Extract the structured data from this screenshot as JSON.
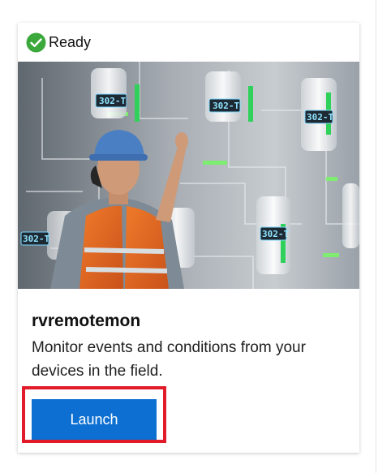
{
  "card": {
    "status": {
      "label": "Ready",
      "icon": "check-circle-icon",
      "color": "#3aa83a"
    },
    "image": {
      "subject": "worker in hard hat and safety vest with industrial tank panels",
      "panel_labels": [
        "302-T",
        "302-T",
        "302-T",
        "302-T",
        "302-T"
      ]
    },
    "title": "rvremotemon",
    "description": "Monitor events and conditions from your devices in the field.",
    "launch_label": "Launch"
  },
  "colors": {
    "accent": "#0c6fd1",
    "highlight": "#e21b2b"
  }
}
